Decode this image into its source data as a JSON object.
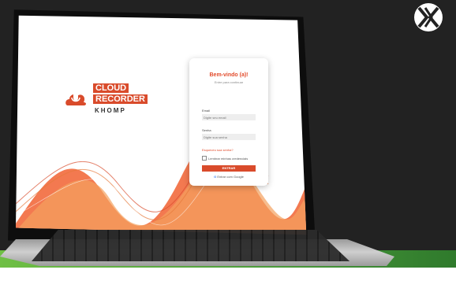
{
  "brand": {
    "name": "KX"
  },
  "logo": {
    "line1": "CLOUD",
    "line2": "RECORDER",
    "line3": "KHOMP"
  },
  "login": {
    "title": "Bem-vindo (a)!",
    "subtitle": "Entre para continuar",
    "email_label": "Email",
    "email_placeholder": "Digite seu email",
    "password_label": "Senha",
    "password_placeholder": "Digite sua senha",
    "forgot": "Esqueceu sua senha?",
    "remember": "Lembrar minhas credenciais",
    "submit": "ENTRAR",
    "google": "Entrar com Google"
  },
  "colors": {
    "accent": "#d94b2b",
    "green": "#6fbf45",
    "dark_bg": "#222222"
  }
}
